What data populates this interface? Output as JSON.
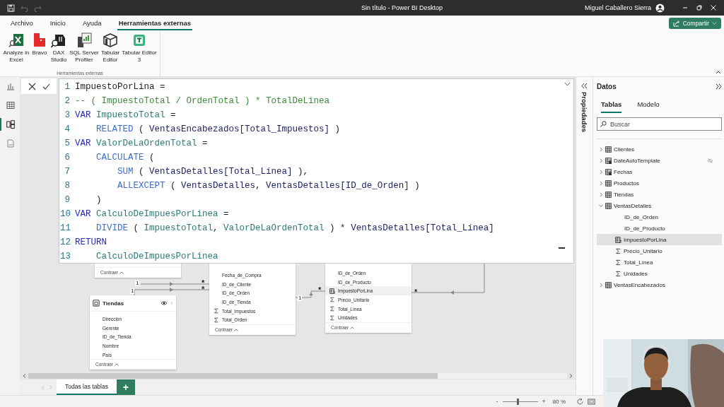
{
  "window": {
    "title": "Sin título - Power BI Desktop",
    "user": "Miguel Caballero Sierra"
  },
  "quick_access": [
    {
      "kind": "save",
      "disabled": false
    },
    {
      "kind": "undo",
      "disabled": true
    },
    {
      "kind": "redo",
      "disabled": true
    }
  ],
  "ribbon_tabs": [
    {
      "label": "Archivo",
      "selected": false
    },
    {
      "label": "Inicio",
      "selected": false
    },
    {
      "label": "Ayuda",
      "selected": false
    },
    {
      "label": "Herramientas externas",
      "selected": true
    }
  ],
  "share_button": "Compartir",
  "ribbon_group": {
    "label": "Herramientas externas",
    "buttons": [
      {
        "kind": "excel",
        "label": "Analyze in Excel"
      },
      {
        "kind": "bravo",
        "label": "Bravo"
      },
      {
        "kind": "dax-studio",
        "label": "DAX Studio"
      },
      {
        "kind": "sql-profiler",
        "label": "SQL Server Profiler"
      },
      {
        "kind": "tabular-editor",
        "label": "Tabular Editor"
      },
      {
        "kind": "tabular-editor-3",
        "label": "Tabular Editor 3"
      }
    ]
  },
  "views": [
    {
      "kind": "report",
      "selected": false
    },
    {
      "kind": "table",
      "selected": false
    },
    {
      "kind": "model",
      "selected": true
    },
    {
      "kind": "query",
      "selected": false
    }
  ],
  "formula_lines": [
    {
      "number": "1",
      "tokens": [
        {
          "kind": "plain",
          "text": "ImpuestoPorLina ="
        }
      ]
    },
    {
      "number": "2",
      "tokens": [
        {
          "kind": "comment",
          "text": "-- ( ImpuestoTotal / OrdenTotal ) * TotalDeLinea"
        }
      ]
    },
    {
      "number": "3",
      "tokens": [
        {
          "kind": "keyword",
          "text": "VAR "
        },
        {
          "kind": "variable",
          "text": "ImpuestoTotal"
        },
        {
          "kind": "plain",
          "text": " ="
        }
      ]
    },
    {
      "number": "4",
      "tokens": [
        {
          "kind": "function",
          "text": "    RELATED"
        },
        {
          "kind": "plain",
          "text": " ( "
        },
        {
          "kind": "table",
          "text": "VentasEncabezados"
        },
        {
          "kind": "column",
          "text": "[Total_Impuestos]"
        },
        {
          "kind": "plain",
          "text": " )"
        }
      ]
    },
    {
      "number": "5",
      "tokens": [
        {
          "kind": "keyword",
          "text": "VAR "
        },
        {
          "kind": "variable",
          "text": "ValorDeLaOrdenTotal"
        },
        {
          "kind": "plain",
          "text": " ="
        }
      ]
    },
    {
      "number": "6",
      "tokens": [
        {
          "kind": "function",
          "text": "    CALCULATE"
        },
        {
          "kind": "plain",
          "text": " ("
        }
      ]
    },
    {
      "number": "7",
      "tokens": [
        {
          "kind": "function",
          "text": "        SUM"
        },
        {
          "kind": "plain",
          "text": " ( "
        },
        {
          "kind": "table",
          "text": "VentasDetalles"
        },
        {
          "kind": "column",
          "text": "[Total_Línea]"
        },
        {
          "kind": "plain",
          "text": " ),"
        }
      ]
    },
    {
      "number": "8",
      "tokens": [
        {
          "kind": "function",
          "text": "        ALLEXCEPT"
        },
        {
          "kind": "plain",
          "text": " ( "
        },
        {
          "kind": "table",
          "text": "VentasDetalles"
        },
        {
          "kind": "plain",
          "text": ", "
        },
        {
          "kind": "table",
          "text": "VentasDetalles"
        },
        {
          "kind": "column",
          "text": "[ID_de_Orden]"
        },
        {
          "kind": "plain",
          "text": " )"
        }
      ]
    },
    {
      "number": "9",
      "tokens": [
        {
          "kind": "plain",
          "text": "    )"
        }
      ]
    },
    {
      "number": "10",
      "tokens": [
        {
          "kind": "keyword",
          "text": "VAR "
        },
        {
          "kind": "variable",
          "text": "CalculoDeImpuesPorLinea"
        },
        {
          "kind": "plain",
          "text": " ="
        }
      ]
    },
    {
      "number": "11",
      "tokens": [
        {
          "kind": "function",
          "text": "    DIVIDE"
        },
        {
          "kind": "plain",
          "text": " ( "
        },
        {
          "kind": "variable",
          "text": "ImpuestoTotal"
        },
        {
          "kind": "plain",
          "text": ", "
        },
        {
          "kind": "variable",
          "text": "ValorDeLaOrdenTotal"
        },
        {
          "kind": "plain",
          "text": " ) * "
        },
        {
          "kind": "table",
          "text": "VentasDetalles"
        },
        {
          "kind": "column",
          "text": "[Total_Línea]"
        }
      ]
    },
    {
      "number": "12",
      "tokens": [
        {
          "kind": "keyword",
          "text": "RETURN"
        }
      ]
    },
    {
      "number": "13",
      "tokens": [
        {
          "kind": "variable",
          "text": "    CalculoDeImpuesPorLinea"
        }
      ]
    }
  ],
  "diagram": {
    "cards": [
      {
        "footer": "Contraer"
      },
      {
        "fields": [
          {
            "name": "Fecha_de_Compra",
            "kind": "column",
            "selected": false
          },
          {
            "name": "ID_de_Cliente",
            "kind": "column",
            "selected": false
          },
          {
            "name": "ID_de_Orden",
            "kind": "column",
            "selected": false
          },
          {
            "name": "ID_de_Tienda",
            "kind": "column",
            "selected": false
          },
          {
            "name": "Total_Impuestos",
            "kind": "sum",
            "selected": false
          },
          {
            "name": "Total_Orden",
            "kind": "sum",
            "selected": false
          }
        ],
        "footer": "Contraer"
      },
      {
        "fields": [
          {
            "name": "ID_de_Orden",
            "kind": "column",
            "selected": false
          },
          {
            "name": "ID_de_Producto",
            "kind": "column",
            "selected": false
          },
          {
            "name": "ImpuestoPorLina",
            "kind": "calculated",
            "selected": true
          },
          {
            "name": "Precio_Unitario",
            "kind": "sum",
            "selected": false
          },
          {
            "name": "Total_Línea",
            "kind": "sum",
            "selected": false
          },
          {
            "name": "Unidades",
            "kind": "sum",
            "selected": false
          }
        ],
        "footer": "Contraer"
      },
      {
        "title": "Tiendas",
        "fields": [
          {
            "name": "Dirección",
            "kind": "column",
            "selected": false
          },
          {
            "name": "Gerente",
            "kind": "column",
            "selected": false
          },
          {
            "name": "ID_de_Tienda",
            "kind": "column",
            "selected": false
          },
          {
            "name": "Nombre",
            "kind": "column",
            "selected": false
          },
          {
            "name": "País",
            "kind": "column",
            "selected": false
          }
        ],
        "footer": "Contraer"
      }
    ],
    "relationships": [
      {
        "start": "1",
        "end": "*"
      },
      {
        "start": "1",
        "end": "*"
      },
      {
        "start": "1",
        "end": "*"
      },
      {
        "end": "*"
      }
    ]
  },
  "page_tabs": [
    {
      "label": "Todas las tablas",
      "selected": true
    }
  ],
  "add_tab_button": "+",
  "properties_pane": {
    "label": "Propiedades"
  },
  "data_pane": {
    "title": "Datos",
    "tabs": [
      {
        "label": "Tablas",
        "selected": true
      },
      {
        "label": "Modelo",
        "selected": false
      }
    ],
    "search": {
      "placeholder": "Buscar"
    },
    "tables": [
      {
        "name": "Clientes",
        "kind": "table",
        "expanded": false,
        "hidden": false,
        "selected": false
      },
      {
        "name": "DateAutoTemplate",
        "kind": "calc-table",
        "expanded": false,
        "hidden": true,
        "selected": false
      },
      {
        "name": "Fechas",
        "kind": "calc-table",
        "expanded": false,
        "hidden": false,
        "selected": false
      },
      {
        "name": "Productos",
        "kind": "table",
        "expanded": false,
        "hidden": false,
        "selected": false
      },
      {
        "name": "Tiendas",
        "kind": "table",
        "expanded": false,
        "hidden": false,
        "selected": false
      },
      {
        "name": "VentasDetalles",
        "kind": "table",
        "expanded": true,
        "hidden": false,
        "selected": false,
        "children": [
          {
            "name": "ID_de_Orden",
            "kind": "column",
            "selected": false
          },
          {
            "name": "ID_de_Producto",
            "kind": "column",
            "selected": false
          },
          {
            "name": "ImpuestoPorLina",
            "kind": "calculated",
            "selected": true
          },
          {
            "name": "Precio_Unitario",
            "kind": "sum",
            "selected": false
          },
          {
            "name": "Total_Línea",
            "kind": "sum",
            "selected": false
          },
          {
            "name": "Unidades",
            "kind": "sum",
            "selected": false
          }
        ]
      },
      {
        "name": "VentasEncabezados",
        "kind": "table",
        "expanded": false,
        "hidden": false,
        "selected": false
      }
    ]
  },
  "status_bar": {
    "zoom_out": "-",
    "zoom_in": "+",
    "zoom": "80 %",
    "level": 0.4
  }
}
